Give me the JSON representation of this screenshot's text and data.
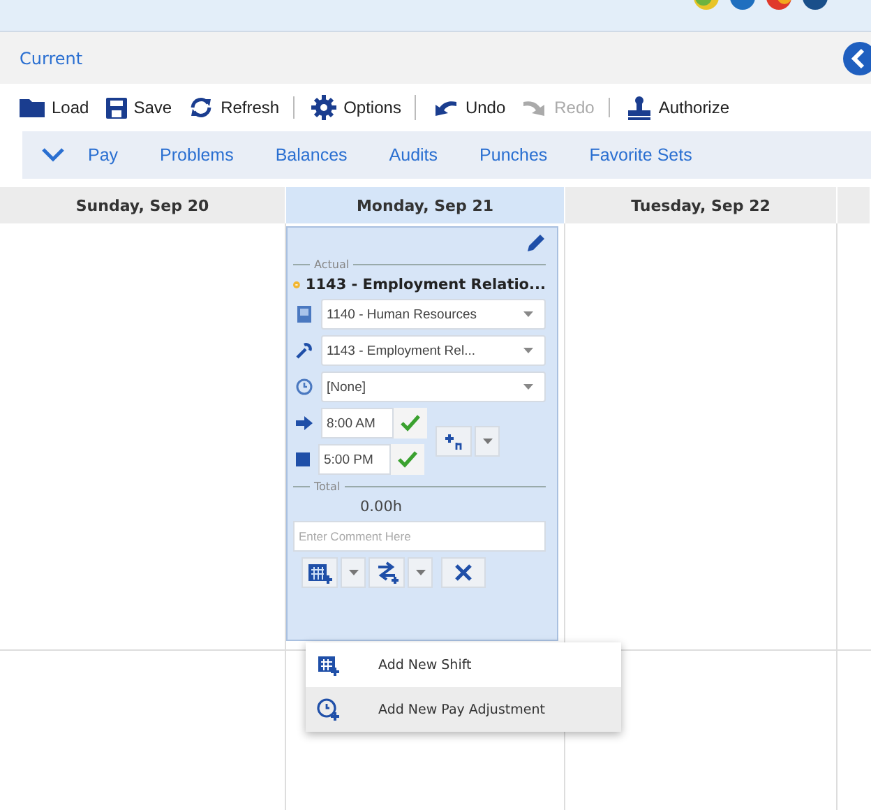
{
  "header": {
    "title": "Current"
  },
  "toolbar": [
    {
      "label": "Load",
      "disabled": false,
      "separator_after": false
    },
    {
      "label": "Save",
      "disabled": false,
      "separator_after": false
    },
    {
      "label": "Refresh",
      "disabled": false,
      "separator_after": true
    },
    {
      "label": "Options",
      "disabled": false,
      "separator_after": true
    },
    {
      "label": "Undo",
      "disabled": false,
      "separator_after": false
    },
    {
      "label": "Redo",
      "disabled": true,
      "separator_after": true
    },
    {
      "label": "Authorize",
      "disabled": false,
      "separator_after": false
    }
  ],
  "tabs": [
    "Pay",
    "Problems",
    "Balances",
    "Audits",
    "Punches",
    "Favorite Sets"
  ],
  "days": [
    {
      "label": "Sunday, Sep 20",
      "selected": false
    },
    {
      "label": "Monday, Sep 21",
      "selected": true
    },
    {
      "label": "Tuesday, Sep 22",
      "selected": false
    }
  ],
  "shift_card": {
    "actual_label": "Actual",
    "title": "1143 - Employment Relatio...",
    "fields": [
      {
        "value": "1140 - Human Resources"
      },
      {
        "value": "1143 - Employment Rel..."
      },
      {
        "value": "[None]"
      }
    ],
    "times": [
      {
        "value": "8:00 AM",
        "valid": true
      },
      {
        "value": "5:00 PM",
        "valid": true
      }
    ],
    "total_label": "Total",
    "total": "0.00h",
    "comment_placeholder": "Enter Comment Here"
  },
  "menu": [
    {
      "label": "Add New Shift",
      "selected": false
    },
    {
      "label": "Add New Pay Adjustment",
      "selected": true
    }
  ]
}
